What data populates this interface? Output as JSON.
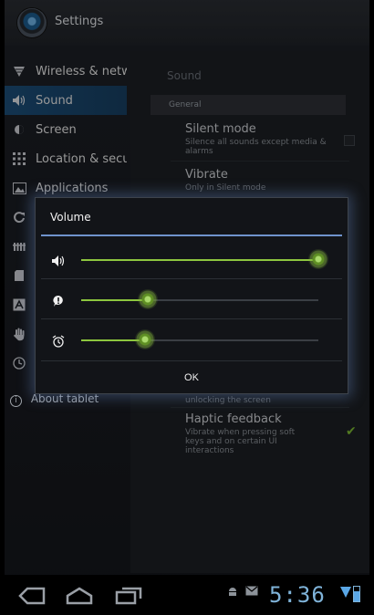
{
  "header": {
    "title": "Settings"
  },
  "sidebar": {
    "items": [
      {
        "label": "Wireless & netw",
        "icon": "wifi-icon"
      },
      {
        "label": "Sound",
        "icon": "speaker-icon",
        "selected": true
      },
      {
        "label": "Screen",
        "icon": "brightness-icon"
      },
      {
        "label": "Location & secur",
        "icon": "grid-lock-icon"
      },
      {
        "label": "Applications",
        "icon": "applications-icon"
      },
      {
        "label": "",
        "icon": "sync-icon"
      },
      {
        "label": "",
        "icon": "privacy-icon"
      },
      {
        "label": "",
        "icon": "storage-icon"
      },
      {
        "label": "",
        "icon": "language-icon"
      },
      {
        "label": "",
        "icon": "accessibility-icon"
      },
      {
        "label": "",
        "icon": "clock-icon"
      },
      {
        "label": "About tablet",
        "icon": "info-icon"
      }
    ]
  },
  "content": {
    "title": "Sound",
    "section": "General",
    "prefs": [
      {
        "title": "Silent mode",
        "summary": "Silence all sounds except media & alarms",
        "checked": false
      },
      {
        "title": "Vibrate",
        "summary": "Only in Silent mode"
      },
      {
        "title": "",
        "summary": "unlocking the screen"
      },
      {
        "title": "Haptic feedback",
        "summary": "Vibrate when pressing soft keys and on certain UI interactions",
        "checked": true
      }
    ]
  },
  "dialog": {
    "title": "Volume",
    "ok_label": "OK",
    "sliders": [
      {
        "icon": "media-volume-icon",
        "level": 1.0
      },
      {
        "icon": "notification-volume-icon",
        "level": 0.28
      },
      {
        "icon": "alarm-volume-icon",
        "level": 0.27
      }
    ]
  },
  "statusbar": {
    "time": "5:36"
  },
  "colors": {
    "accent": "#8dc63f",
    "selection": "#1c4f7a",
    "dialog_line": "#6f93cc",
    "clock": "#7fb3d9"
  }
}
